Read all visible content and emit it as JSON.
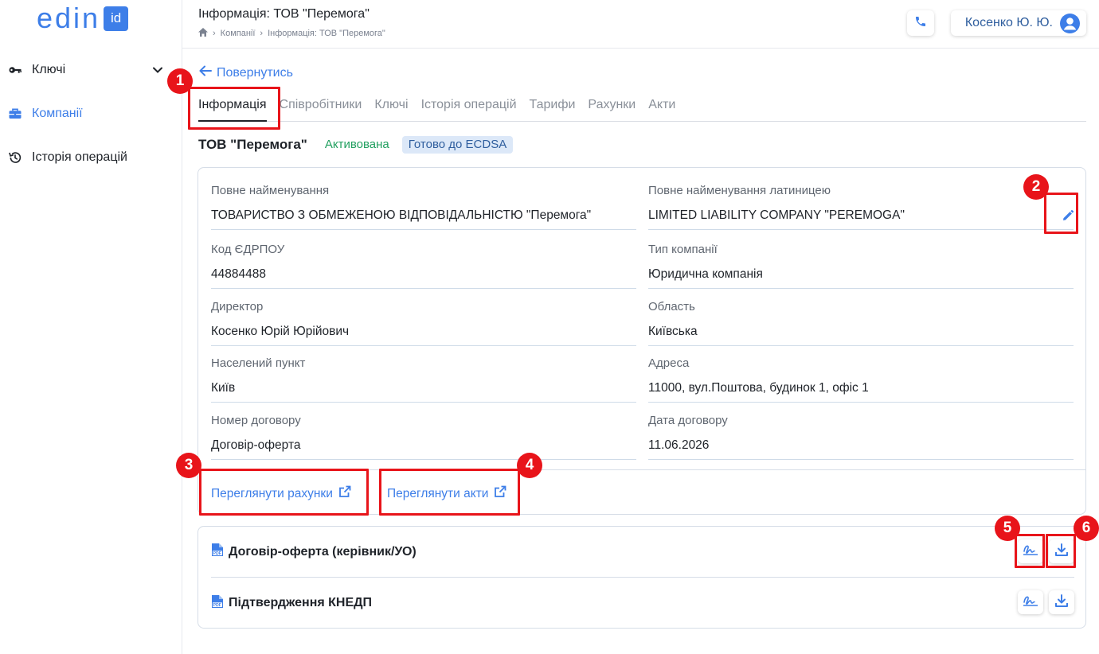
{
  "app": {
    "logo_text": "edin",
    "logo_badge": "id",
    "brand_color": "#3d7ee8"
  },
  "sidebar": {
    "items": [
      {
        "label": "Ключі",
        "icon": "key-icon",
        "has_chevron": true
      },
      {
        "label": "Компанії",
        "icon": "briefcase-icon",
        "active": true
      },
      {
        "label": "Історія операцій",
        "icon": "history-icon"
      }
    ]
  },
  "header": {
    "title": "Інформація: ТОВ \"Перемога\"",
    "breadcrumb": [
      "Компанії",
      "Інформація: ТОВ \"Перемога\""
    ],
    "user_name": "Косенко Ю. Ю."
  },
  "main": {
    "back_label": "Повернутись",
    "tabs": [
      {
        "label": "Інформація",
        "active": true
      },
      {
        "label": "Співробітники"
      },
      {
        "label": "Ключі"
      },
      {
        "label": "Історія операцій"
      },
      {
        "label": "Тарифи"
      },
      {
        "label": "Рахунки"
      },
      {
        "label": "Акти"
      }
    ],
    "company_name": "ТОВ \"Перемога\"",
    "status_badges": [
      "Активована",
      "Готово до ECDSA"
    ],
    "fields": [
      {
        "label": "Повне найменування",
        "value": "ТОВАРИСТВО З ОБМЕЖЕНОЮ ВІДПОВІДАЛЬНІСТЮ \"Перемога\""
      },
      {
        "label": "Повне найменування латиницею",
        "value": "LIMITED LIABILITY COMPANY \"PEREMOGA\""
      },
      {
        "label": "Код ЄДРПОУ",
        "value": "44884488"
      },
      {
        "label": "Тип компанії",
        "value": "Юридична компанія"
      },
      {
        "label": "Директор",
        "value": "Косенко Юрій Юрійович"
      },
      {
        "label": "Область",
        "value": "Київська"
      },
      {
        "label": "Населений пункт",
        "value": "Київ"
      },
      {
        "label": "Адреса",
        "value": "11000, вул.Поштова, будинок 1, офіс 1"
      },
      {
        "label": "Номер договору",
        "value": "Договір-оферта"
      },
      {
        "label": "Дата договору",
        "value": "11.06.2026"
      }
    ],
    "links": [
      "Переглянути рахунки",
      "Переглянути акти"
    ],
    "documents": [
      {
        "title": "Договір-оферта (керівник/УО)"
      },
      {
        "title": "Підтвердження КНЕДП"
      }
    ]
  },
  "annotations": {
    "markers": [
      "1",
      "2",
      "3",
      "4",
      "5",
      "6"
    ],
    "color": "#e8141a"
  }
}
